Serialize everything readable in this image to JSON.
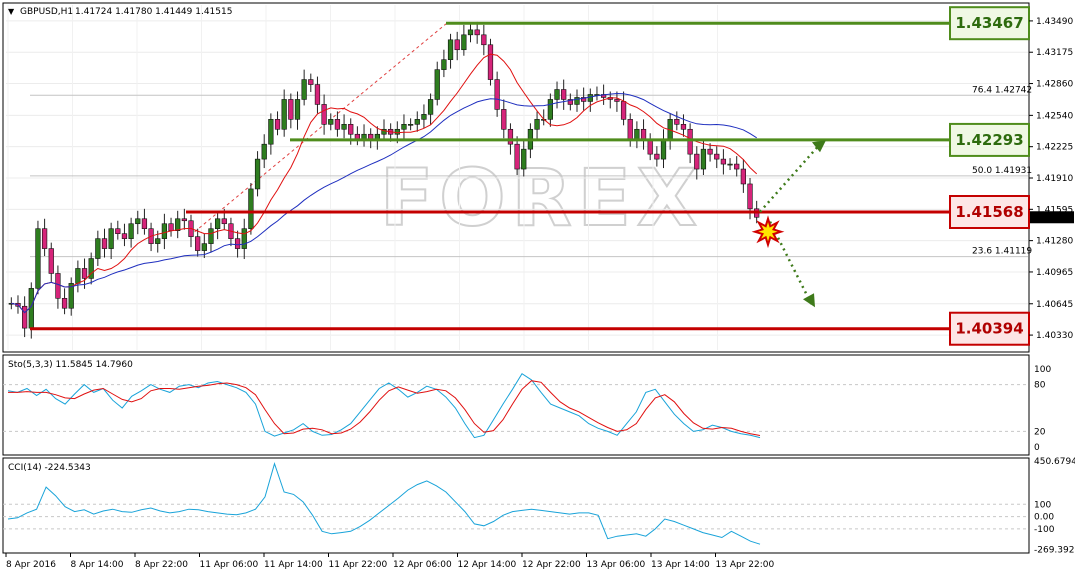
{
  "header": {
    "symbol": "GBPUSD,H1",
    "ohlc": "1.41724 1.41780 1.41449 1.41515",
    "stoch_label": "Sto(5,3,3) 11.5845 14.7960",
    "cci_label": "CCI(14) -224.5343"
  },
  "watermark": "FOREX",
  "colors": {
    "background": "#ffffff",
    "bull": "#2e7d1f",
    "bear": "#d6247a",
    "ma_fast": "#e01010",
    "ma_slow": "#1f2fbf",
    "stoch_main": "#19a3d9",
    "stoch_signal": "#e01010",
    "cci": "#19a3d9",
    "resistance": "#4f8c1c",
    "support": "#c40000",
    "projection": "#3e7a1a"
  },
  "chart_data": [
    {
      "type": "candlestick",
      "title": "GBPUSD,H1",
      "ylim": [
        1.4018,
        1.4365
      ],
      "y_ticks": [
        "1.43490",
        "1.43175",
        "1.42860",
        "1.42540",
        "1.42225",
        "1.41910",
        "1.41595",
        "1.41280",
        "1.40965",
        "1.40645",
        "1.40330"
      ],
      "current_price": "1.41515",
      "x_ticks": [
        "8 Apr 2016",
        "8 Apr 14:00",
        "8 Apr 22:00",
        "11 Apr 06:00",
        "11 Apr 14:00",
        "11 Apr 22:00",
        "12 Apr 06:00",
        "12 Apr 14:00",
        "12 Apr 22:00",
        "13 Apr 06:00",
        "13 Apr 14:00",
        "13 Apr 22:00"
      ],
      "fib_labels": [
        {
          "text": "76.4  1.42742",
          "price": 1.42742
        },
        {
          "text": "50.0  1.41931",
          "price": 1.41931
        },
        {
          "text": "23.6  1.41119",
          "price": 1.41119
        }
      ],
      "levels": [
        {
          "value": "1.43467",
          "price": 1.43467,
          "kind": "resistance"
        },
        {
          "value": "1.42293",
          "price": 1.42293,
          "kind": "resistance"
        },
        {
          "value": "1.41568",
          "price": 1.41568,
          "kind": "support"
        },
        {
          "value": "1.40394",
          "price": 1.40394,
          "kind": "support"
        }
      ],
      "ohlc_seed": [
        1.4065,
        1.4062,
        1.404,
        1.408,
        1.414,
        1.412,
        1.4095,
        1.407,
        1.406,
        1.4085,
        1.41,
        1.409,
        1.411,
        1.413,
        1.412,
        1.414,
        1.4135,
        1.413,
        1.4145,
        1.415,
        1.414,
        1.4125,
        1.413,
        1.4145,
        1.4138,
        1.415,
        1.4148,
        1.4132,
        1.4118,
        1.4125,
        1.414,
        1.415,
        1.4145,
        1.413,
        1.412,
        1.414,
        1.418,
        1.421,
        1.4225,
        1.425,
        1.424,
        1.427,
        1.425,
        1.427,
        1.429,
        1.4285,
        1.4265,
        1.4245,
        1.425,
        1.424,
        1.4245,
        1.4235,
        1.423,
        1.4235,
        1.423,
        1.4235,
        1.424,
        1.4235,
        1.424,
        1.4245,
        1.4245,
        1.425,
        1.4255,
        1.427,
        1.43,
        1.431,
        1.433,
        1.432,
        1.4335,
        1.434,
        1.4335,
        1.4325,
        1.429,
        1.426,
        1.424,
        1.4225,
        1.42,
        1.422,
        1.424,
        1.425,
        1.425,
        1.427,
        1.428,
        1.427,
        1.4265,
        1.4272,
        1.4268,
        1.4275,
        1.4275,
        1.4272,
        1.427,
        1.4268,
        1.425,
        1.423,
        1.424,
        1.423,
        1.4215,
        1.421,
        1.423,
        1.425,
        1.4245,
        1.424,
        1.4215,
        1.42,
        1.422,
        1.4215,
        1.421,
        1.4205,
        1.4205,
        1.42,
        1.4185,
        1.416,
        1.41515
      ]
    },
    {
      "type": "line",
      "title": "Sto(5,3,3) 11.5845 14.7960",
      "ylim": [
        0,
        100
      ],
      "y_ticks": [
        "100",
        "80",
        "20",
        "0"
      ],
      "series": [
        {
          "name": "main",
          "values": [
            72,
            70,
            75,
            66,
            74,
            62,
            55,
            68,
            80,
            70,
            75,
            60,
            50,
            65,
            72,
            80,
            74,
            70,
            78,
            80,
            76,
            82,
            84,
            80,
            76,
            70,
            55,
            20,
            14,
            18,
            22,
            30,
            20,
            15,
            16,
            22,
            30,
            45,
            60,
            75,
            82,
            74,
            64,
            70,
            78,
            74,
            64,
            50,
            30,
            12,
            15,
            35,
            55,
            74,
            94,
            86,
            70,
            55,
            50,
            45,
            40,
            30,
            24,
            20,
            15,
            30,
            45,
            70,
            74,
            58,
            42,
            30,
            20,
            22,
            28,
            25,
            20,
            17,
            15,
            12
          ]
        },
        {
          "name": "signal",
          "values": [
            70,
            70,
            71,
            70,
            70,
            67,
            63,
            62,
            68,
            73,
            75,
            68,
            61,
            58,
            62,
            72,
            75,
            75,
            74,
            76,
            78,
            79,
            81,
            82,
            80,
            76,
            67,
            48,
            30,
            17,
            18,
            23,
            24,
            22,
            17,
            18,
            23,
            32,
            45,
            60,
            72,
            77,
            73,
            69,
            71,
            74,
            72,
            63,
            48,
            30,
            19,
            21,
            35,
            55,
            74,
            85,
            83,
            70,
            58,
            50,
            45,
            38,
            31,
            25,
            20,
            22,
            30,
            48,
            63,
            67,
            58,
            43,
            31,
            24,
            23,
            25,
            24,
            20,
            17,
            14.8
          ]
        }
      ]
    },
    {
      "type": "line",
      "title": "CCI(14) -224.5343",
      "ylim": [
        -280,
        460
      ],
      "y_ticks": [
        "450.6794",
        "100",
        "0.00",
        "-100",
        "-269.3921"
      ],
      "series": [
        {
          "name": "CCI(14)",
          "values": [
            -20,
            -10,
            30,
            60,
            240,
            170,
            80,
            40,
            55,
            20,
            45,
            60,
            40,
            35,
            55,
            70,
            45,
            30,
            40,
            60,
            55,
            40,
            30,
            20,
            15,
            30,
            60,
            160,
            430,
            200,
            180,
            120,
            10,
            -120,
            -140,
            -130,
            -120,
            -80,
            -30,
            30,
            90,
            150,
            215,
            260,
            290,
            250,
            200,
            120,
            40,
            -60,
            -75,
            -40,
            10,
            40,
            50,
            60,
            50,
            40,
            30,
            20,
            30,
            30,
            10,
            -180,
            -160,
            -150,
            -140,
            -160,
            -100,
            -20,
            -40,
            -70,
            -100,
            -130,
            -150,
            -170,
            -120,
            -160,
            -200,
            -224.5343
          ]
        }
      ]
    }
  ]
}
